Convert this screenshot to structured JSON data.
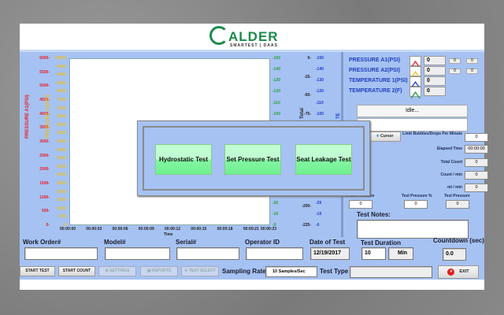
{
  "logo": {
    "brand": "ALDER",
    "sub": "SMARTEST | DAAS"
  },
  "chart_data": {
    "type": "line",
    "xlabel": "Time",
    "x_ticks": [
      "00:00:00",
      "00:00:03",
      "00:00:06",
      "00:00:09",
      "00:00:12",
      "00:00:15",
      "00:00:18",
      "00:00:21",
      "00:00:23"
    ],
    "axes": [
      {
        "label": "PRESSURE A1(PSI)",
        "color": "#e8202a",
        "min": 0,
        "max": 6000,
        "step": 500
      },
      {
        "label": "PRESSURE A2(PSI)",
        "color": "#e8c020",
        "min": 0,
        "max": 10000,
        "step": 500
      },
      {
        "label": "",
        "color": "#2aa040",
        "min": 0,
        "max": 150,
        "step": 10
      },
      {
        "label": "Total",
        "color": "#222222",
        "min": -225,
        "max": 0,
        "step": 25
      },
      {
        "label": "TE",
        "color": "#2040d0",
        "min": 0,
        "max": 150,
        "step": 10
      }
    ],
    "series": []
  },
  "legend": [
    {
      "name": "PRESSURE A1(PSI)",
      "value": "0",
      "color": "#e8202a"
    },
    {
      "name": "PRESSURE A2(PSI)",
      "value": "0",
      "color": "#e8c020"
    },
    {
      "name": "TEMPERATURE 1(PSI)",
      "value": "0",
      "color": "#2040d0"
    },
    {
      "name": "TEMPERATURE 2(F)",
      "value": "0",
      "color": "#20a040"
    }
  ],
  "status": "Idle...",
  "cursor_label": "Cursor",
  "stats": {
    "limit_label": "Limit Bubbles/Drops Per Minute",
    "limit_value": "0",
    "elapsed_label": "Elapsed Time",
    "elapsed_value": "00:00:00",
    "total_label": "Total Count",
    "total_value": "0",
    "countmin_label": "Count / min",
    "countmin_value": "0",
    "mlmin_label": "ml / min",
    "mlmin_value": "0"
  },
  "pressures": {
    "set_label": "te Set Pressure",
    "set_value": "0",
    "pct_label": "Test Pressure %",
    "pct_value": "0",
    "test_label": "Test Pressure",
    "test_value": "0"
  },
  "notes_label": "Test Notes:",
  "form": {
    "work_order": "Work Order#",
    "model": "Model#",
    "serial": "Serial#",
    "operator": "Operator ID",
    "date_label": "Date of Test",
    "date_value": "12/19/2017",
    "duration_label": "Test Duration",
    "duration_value": "10",
    "duration_unit": "Min",
    "countdown_label": "Countdown (sec)",
    "countdown_value": "0.0"
  },
  "toolbar": {
    "start_test": "START TEST",
    "start_count": "START COUNT",
    "settings": "SETTINGS",
    "reports": "REPORTS",
    "test_select": "TEST SELECT",
    "sampling_label": "Sampling Rate",
    "sampling_value": "10 Samples/Sec",
    "test_type_label": "Test Type",
    "exit": "EXIT"
  },
  "dialog": {
    "buttons": [
      "Hydrostatic Test",
      "Set Pressure Test",
      "Seat Leakage Test"
    ]
  }
}
